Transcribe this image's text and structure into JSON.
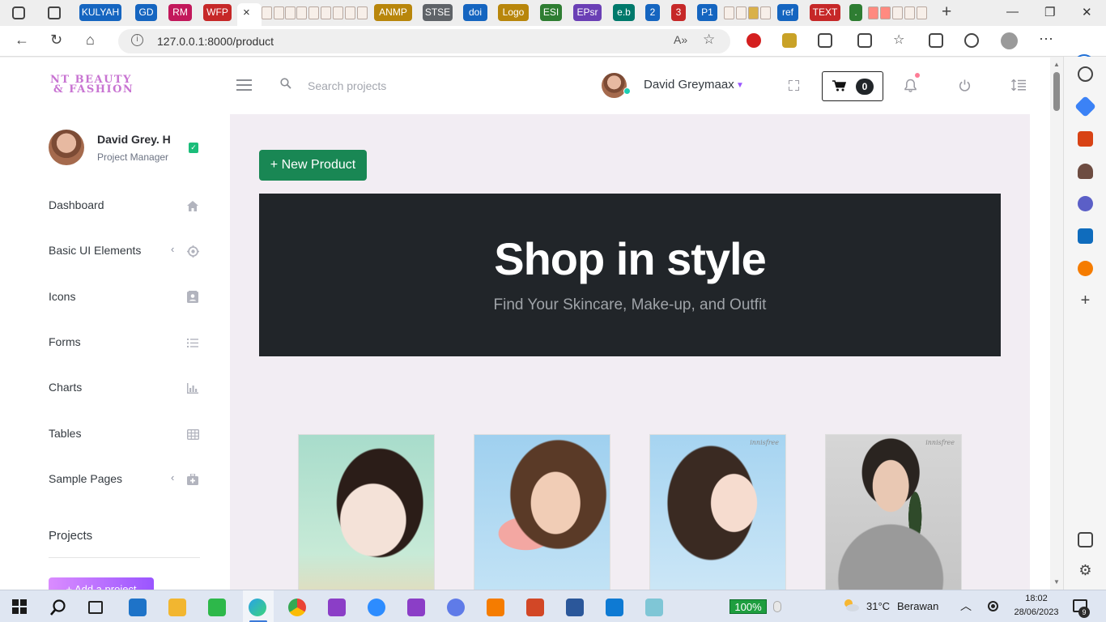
{
  "browser": {
    "tabs": [
      "KULYAH",
      "GD",
      "RM",
      "WFP",
      "ANMP",
      "STSE",
      "doi",
      "Logo",
      "ESI",
      "EPsr",
      "e.b",
      "2",
      "3",
      "P1",
      "ref",
      "TEXT",
      "."
    ],
    "active_tab_close": "×",
    "new_tab": "+",
    "window_controls": [
      "—",
      "❐",
      "✕"
    ],
    "url": "127.0.0.1:8000/product",
    "url_info": "i",
    "read_aloud": "A»",
    "favorite": "☆",
    "menu": "···",
    "copilot": "b"
  },
  "sidebar": {
    "logo_line1": "NT BEAUTY",
    "logo_line2": "& FASHION",
    "user_name": "David Grey. H",
    "user_role": "Project Manager",
    "nav": [
      {
        "label": "Dashboard",
        "icon": "home-icon",
        "chevron": ""
      },
      {
        "label": "Basic UI Elements",
        "icon": "crosshairs-icon",
        "chevron": "‹"
      },
      {
        "label": "Icons",
        "icon": "contacts-icon",
        "chevron": ""
      },
      {
        "label": "Forms",
        "icon": "list-icon",
        "chevron": ""
      },
      {
        "label": "Charts",
        "icon": "bar-chart-icon",
        "chevron": ""
      },
      {
        "label": "Tables",
        "icon": "table-icon",
        "chevron": ""
      },
      {
        "label": "Sample Pages",
        "icon": "medical-bag-icon",
        "chevron": "‹"
      }
    ],
    "projects_title": "Projects",
    "add_project_label": "+ Add a project"
  },
  "topnav": {
    "search_placeholder": "Search projects",
    "user_name": "David Greymaax",
    "cart_count": "0"
  },
  "content": {
    "new_product_label": "+ New Product",
    "hero_title": "Shop in style",
    "hero_subtitle": "Find Your Skincare, Make-up, and Outfit",
    "products": [
      {
        "brand": ""
      },
      {
        "brand": ""
      },
      {
        "brand": "innisfree"
      },
      {
        "brand": "innisfree"
      }
    ]
  },
  "taskbar": {
    "zoom_level": "100%",
    "temperature": "31°C",
    "weather": "Berawan",
    "time": "18:02",
    "date": "28/06/2023",
    "notifications": "9"
  },
  "colors": {
    "primary_green": "#198754",
    "hero_bg": "#212529",
    "content_bg": "#f2edf3",
    "accent_purple": "#9a55ff"
  }
}
